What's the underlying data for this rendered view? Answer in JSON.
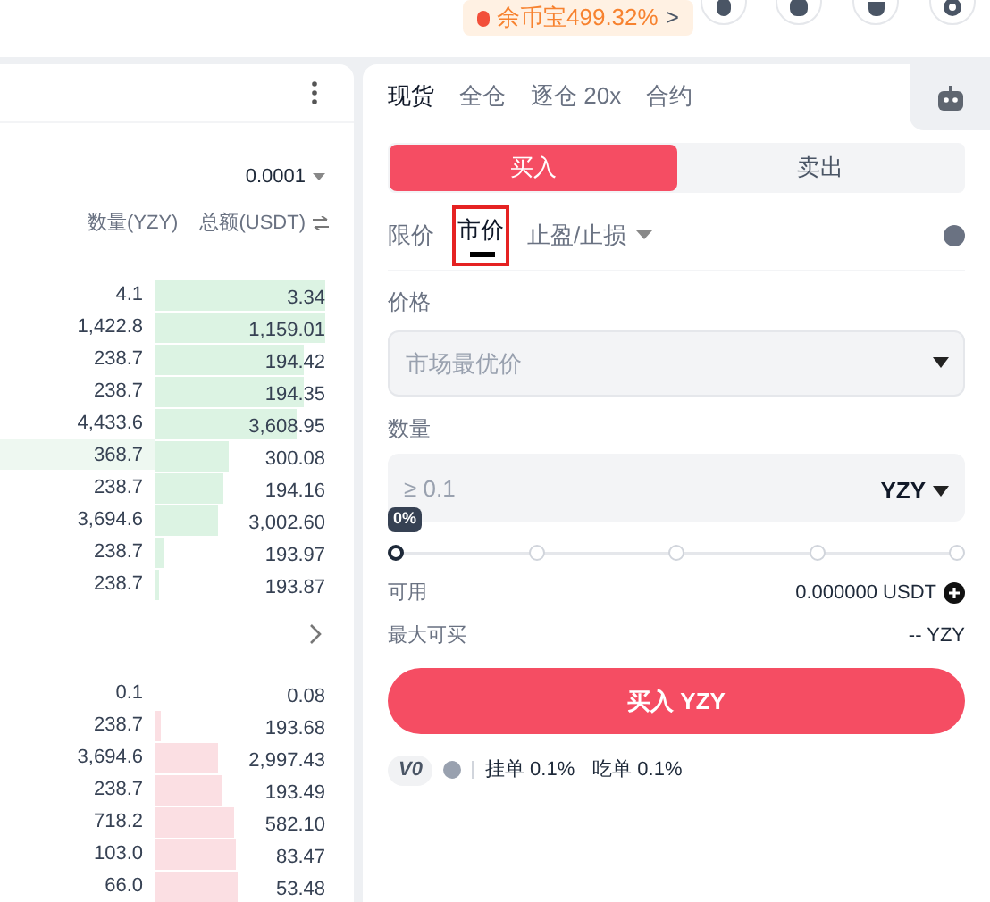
{
  "promo": {
    "text": "余币宝499.32%",
    "arrow": ">"
  },
  "order_book": {
    "precision": "0.0001",
    "columns": [
      "数量(YZY)",
      "总额(USDT)"
    ],
    "bids": [
      {
        "qty": "4.1",
        "total": "3.34",
        "level": 1,
        "highlighted": false
      },
      {
        "qty": "1,422.8",
        "total": "1,159.01",
        "level": 1,
        "highlighted": false
      },
      {
        "qty": "238.7",
        "total": "194.42",
        "level": 0.87,
        "highlighted": false
      },
      {
        "qty": "238.7",
        "total": "194.35",
        "level": 0.87,
        "highlighted": false
      },
      {
        "qty": "4,433.6",
        "total": "3,608.95",
        "level": 0.83,
        "highlighted": false
      },
      {
        "qty": "368.7",
        "total": "300.08",
        "level": 0.43,
        "highlighted": true
      },
      {
        "qty": "238.7",
        "total": "194.16",
        "level": 0.4,
        "highlighted": false
      },
      {
        "qty": "3,694.6",
        "total": "3,002.60",
        "level": 0.37,
        "highlighted": false
      },
      {
        "qty": "238.7",
        "total": "193.97",
        "level": 0.05,
        "highlighted": false
      },
      {
        "qty": "238.7",
        "total": "193.87",
        "level": 0.02,
        "highlighted": false
      }
    ],
    "asks": [
      {
        "qty": "0.1",
        "total": "0.08",
        "level": 0
      },
      {
        "qty": "238.7",
        "total": "193.68",
        "level": 0.03
      },
      {
        "qty": "3,694.6",
        "total": "2,997.43",
        "level": 0.37
      },
      {
        "qty": "238.7",
        "total": "193.49",
        "level": 0.39
      },
      {
        "qty": "718.2",
        "total": "582.10",
        "level": 0.46
      },
      {
        "qty": "103.0",
        "total": "83.47",
        "level": 0.47
      },
      {
        "qty": "66.0",
        "total": "53.48",
        "level": 0.48
      }
    ]
  },
  "account_tabs": [
    {
      "label": "现货",
      "selected": true
    },
    {
      "label": "全仓",
      "selected": false
    },
    {
      "label": "逐仓 20x",
      "selected": false
    },
    {
      "label": "合约",
      "selected": false
    }
  ],
  "side_tabs": [
    {
      "label": "买入",
      "selected": true
    },
    {
      "label": "卖出",
      "selected": false
    }
  ],
  "order_types": [
    {
      "label": "限价",
      "selected": false,
      "dropdown": false
    },
    {
      "label": "市价",
      "selected": true,
      "dropdown": false
    },
    {
      "label": "止盈/止损",
      "selected": false,
      "dropdown": true
    }
  ],
  "price": {
    "label": "价格",
    "placeholder": "市场最优价"
  },
  "amount": {
    "label": "数量",
    "placeholder": "≥ 0.1",
    "unit": "YZY"
  },
  "slider": {
    "tooltip": "0%",
    "level": 0
  },
  "available": {
    "label": "可用",
    "value": "0.000000 USDT"
  },
  "max_buy": {
    "label": "最大可买",
    "value": "-- YZY"
  },
  "submit": "买入 YZY",
  "fees": {
    "tier": "V0",
    "maker": "挂单 0.1%",
    "taker": "吃单 0.1%"
  }
}
